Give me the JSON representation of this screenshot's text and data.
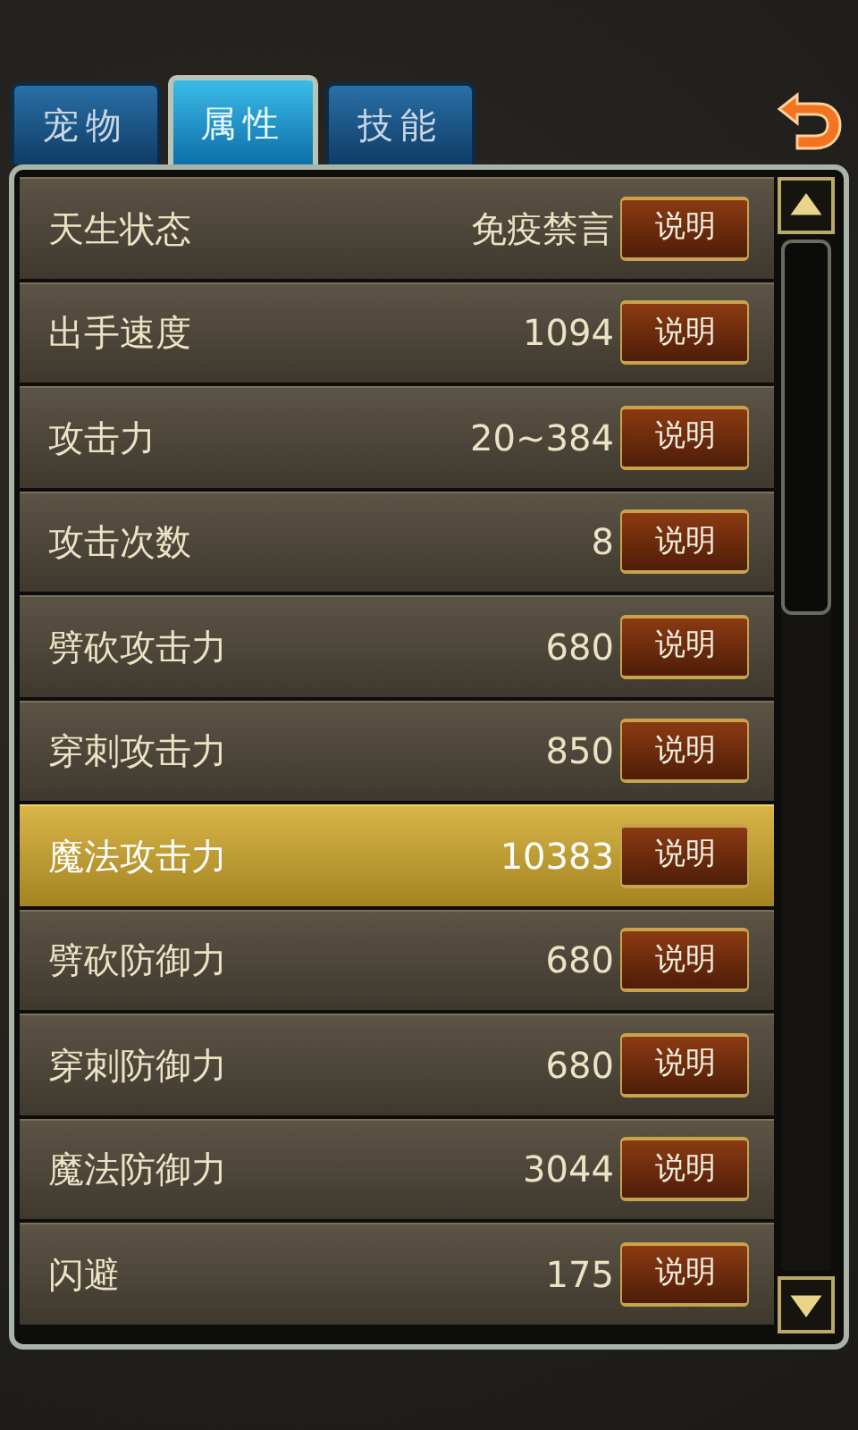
{
  "tabs": [
    {
      "label": "宠物",
      "selected": false
    },
    {
      "label": "属性",
      "selected": true
    },
    {
      "label": "技能",
      "selected": false
    }
  ],
  "attributes": [
    {
      "name": "天生状态",
      "value": "免疫禁言",
      "button": "说明",
      "selected": false
    },
    {
      "name": "出手速度",
      "value": "1094",
      "button": "说明",
      "selected": false
    },
    {
      "name": "攻击力",
      "value": "20~384",
      "button": "说明",
      "selected": false
    },
    {
      "name": "攻击次数",
      "value": "8",
      "button": "说明",
      "selected": false
    },
    {
      "name": "劈砍攻击力",
      "value": "680",
      "button": "说明",
      "selected": false
    },
    {
      "name": "穿刺攻击力",
      "value": "850",
      "button": "说明",
      "selected": false
    },
    {
      "name": "魔法攻击力",
      "value": "10383",
      "button": "说明",
      "selected": true
    },
    {
      "name": "劈砍防御力",
      "value": "680",
      "button": "说明",
      "selected": false
    },
    {
      "name": "穿刺防御力",
      "value": "680",
      "button": "说明",
      "selected": false
    },
    {
      "name": "魔法防御力",
      "value": "3044",
      "button": "说明",
      "selected": false
    },
    {
      "name": "闪避",
      "value": "175",
      "button": "说明",
      "selected": false
    }
  ]
}
